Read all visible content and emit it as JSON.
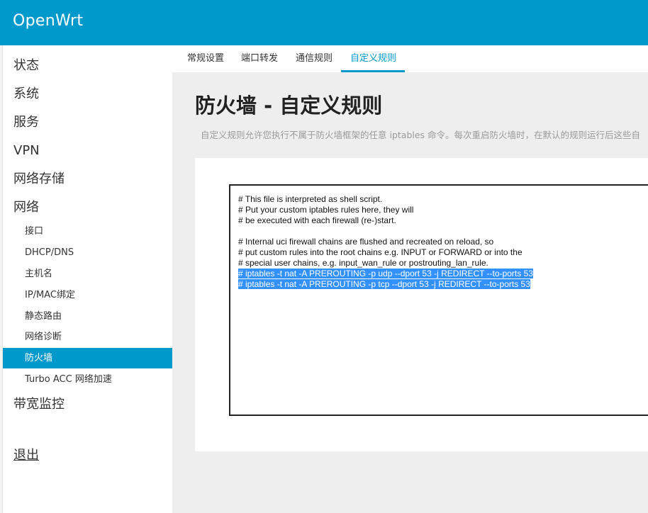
{
  "header": {
    "brand": "OpenWrt"
  },
  "sidebar": {
    "top_items": [
      "状态",
      "系统",
      "服务",
      "VPN",
      "网络存储",
      "网络"
    ],
    "network_items": [
      "接口",
      "DHCP/DNS",
      "主机名",
      "IP/MAC绑定",
      "静态路由",
      "网络诊断",
      "防火墙",
      "Turbo ACC 网络加速"
    ],
    "active_item": "防火墙",
    "bandwidth": "带宽监控",
    "logout": "退出"
  },
  "tabs": [
    "常规设置",
    "端口转发",
    "通信规则",
    "自定义规则"
  ],
  "active_tab": "自定义规则",
  "page": {
    "title": "防火墙 - 自定义规则",
    "description": "自定义规则允许您执行不属于防火墙框架的任意 iptables 命令。每次重启防火墙时，在默认的规则运行后这些自"
  },
  "editor": {
    "lines": [
      "# This file is interpreted as shell script.",
      "# Put your custom iptables rules here, they will",
      "# be executed with each firewall (re-)start.",
      "",
      "# Internal uci firewall chains are flushed and recreated on reload, so",
      "# put custom rules into the root chains e.g. INPUT or FORWARD or into the",
      "# special user chains, e.g. input_wan_rule or postrouting_lan_rule.",
      "# iptables -t nat -A PREROUTING -p udp --dport 53 -j REDIRECT --to-ports 53",
      "# iptables -t nat -A PREROUTING -p tcp --dport 53 -j REDIRECT --to-ports 53"
    ],
    "selected_lines": [
      7,
      8
    ]
  },
  "colors": {
    "accent": "#0099cc",
    "selection": "#3390ff",
    "content_bg": "#eeeeee"
  }
}
